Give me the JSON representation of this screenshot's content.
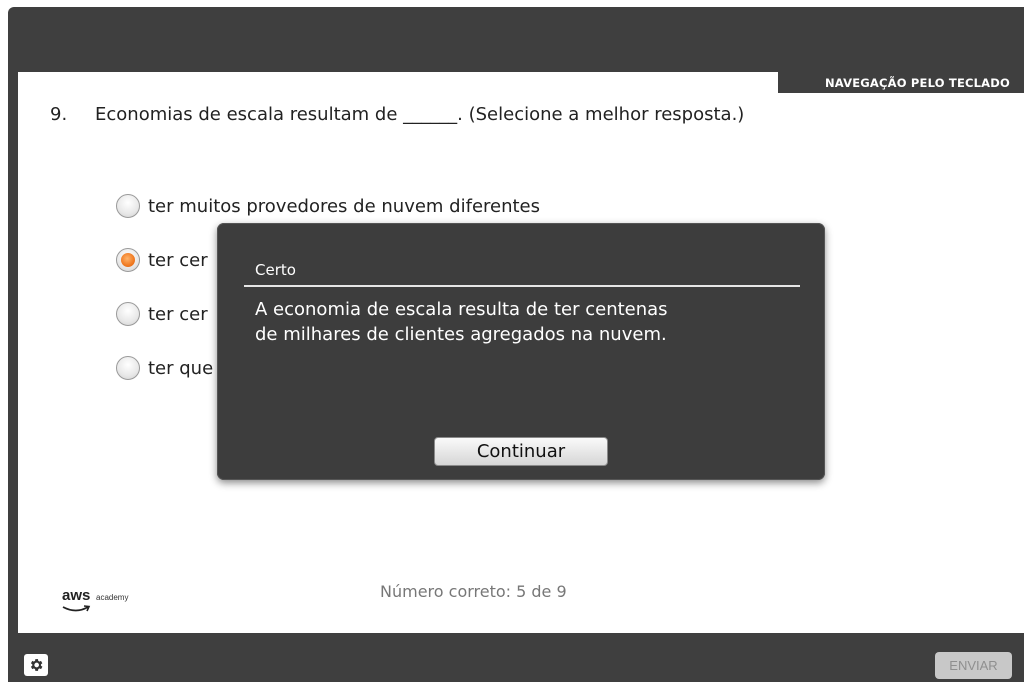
{
  "header": {
    "keyboard_nav_label": "NAVEGAÇÃO PELO TECLADO"
  },
  "question": {
    "number": "9.",
    "text": "Economias de escala resultam de ______. (Selecione a melhor resposta.)"
  },
  "options": [
    {
      "label": "ter muitos provedores de nuvem diferentes",
      "selected": false
    },
    {
      "label": "ter cer",
      "selected": true
    },
    {
      "label": "ter cer",
      "selected": false
    },
    {
      "label": "ter que",
      "selected": false
    }
  ],
  "feedback": {
    "title": "Certo",
    "body_line1": "A economia de escala resulta de ter centenas",
    "body_line2": "de milhares de clientes agregados na nuvem.",
    "continue_label": "Continuar"
  },
  "footer": {
    "score_text": "Número correto: 5 de 9",
    "logo_word": "aws",
    "logo_sub": "academy"
  },
  "bottom_bar": {
    "settings_icon": "gear-icon",
    "submit_label": "ENVIAR"
  },
  "colors": {
    "frame": "#3f3f3f",
    "radio_selected": "#f07a22",
    "overlay": "#3d3d3d"
  }
}
